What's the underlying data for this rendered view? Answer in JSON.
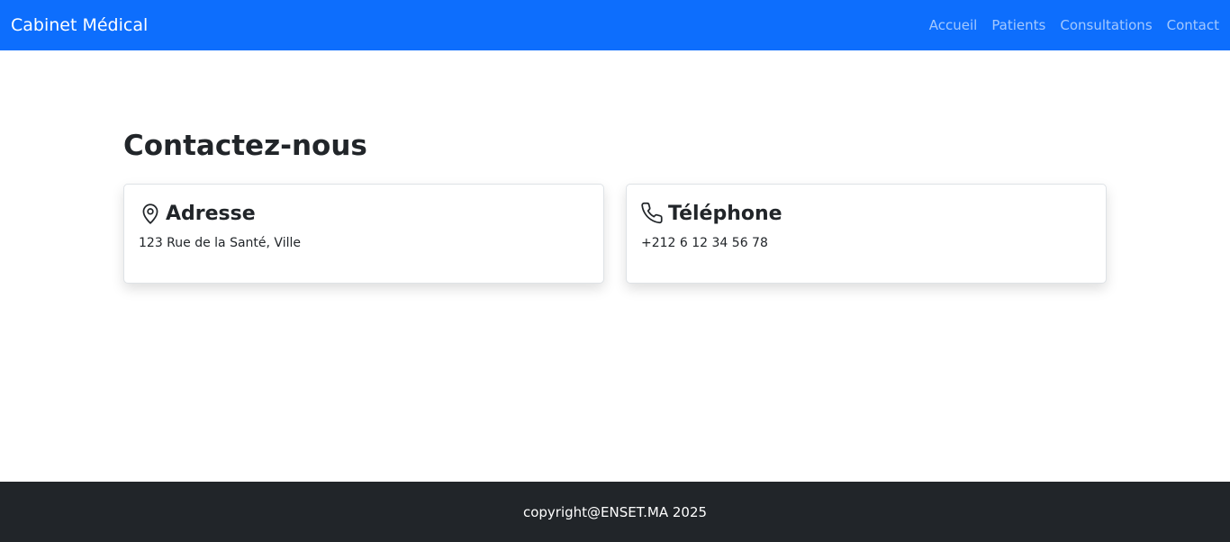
{
  "navbar": {
    "brand": "Cabinet Médical",
    "links": [
      "Accueil",
      "Patients",
      "Consultations",
      "Contact"
    ]
  },
  "main": {
    "title": "Contactez-nous",
    "cards": [
      {
        "icon": "map-pin-icon",
        "title": "Adresse",
        "text": "123 Rue de la Santé, Ville"
      },
      {
        "icon": "phone-icon",
        "title": "Téléphone",
        "text": "+212 6 12 34 56 78"
      }
    ]
  },
  "footer": {
    "text": "copyright@ENSET.MA 2025"
  },
  "colors": {
    "primary": "#0d6efd",
    "dark": "#212529"
  }
}
